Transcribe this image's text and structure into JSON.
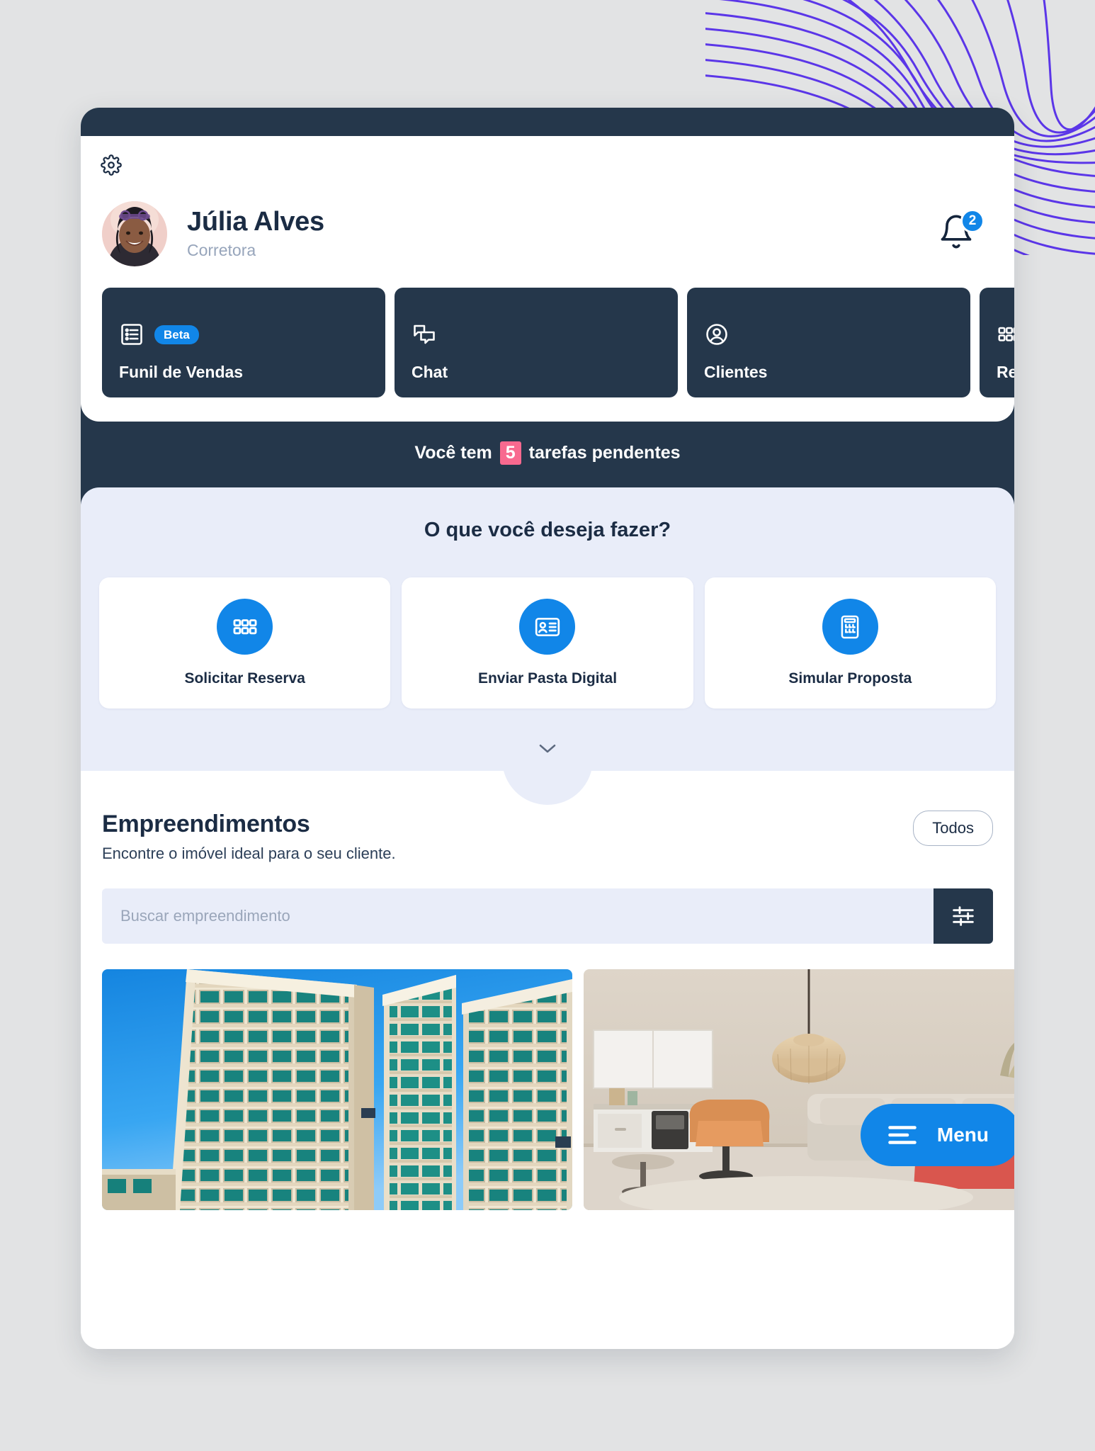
{
  "header": {
    "gear_icon": "gear-icon",
    "profile": {
      "name": "Júlia Alves",
      "role": "Corretora",
      "avatar_icon": "avatar"
    },
    "notifications": {
      "icon": "bell-icon",
      "count": "2"
    }
  },
  "nav_cards": [
    {
      "label": "Funil de Vendas",
      "icon": "list-icon",
      "badge": "Beta"
    },
    {
      "label": "Chat",
      "icon": "chat-bubbles-icon",
      "badge": ""
    },
    {
      "label": "Clientes",
      "icon": "user-circle-icon",
      "badge": ""
    },
    {
      "label": "Reservas",
      "icon": "grid-icon",
      "badge": ""
    }
  ],
  "tasks_banner": {
    "prefix": "Você  tem",
    "count": "5",
    "suffix": "tarefas pendentes"
  },
  "actions": {
    "title": "O que você deseja fazer?",
    "cards": [
      {
        "label": "Solicitar Reserva",
        "icon": "grid-icon"
      },
      {
        "label": "Enviar Pasta Digital",
        "icon": "id-card-icon"
      },
      {
        "label": "Simular Proposta",
        "icon": "calculator-icon"
      }
    ],
    "collapse_icon": "chevron-down-icon"
  },
  "listings": {
    "title": "Empreendimentos",
    "subtitle": "Encontre o imóvel ideal para o seu cliente.",
    "filter_pill": "Todos",
    "search_placeholder": "Buscar empreendimento",
    "search_value": "",
    "filter_button_icon": "sliders-icon",
    "gallery": [
      {
        "name": "building-exterior-photo"
      },
      {
        "name": "apartment-interior-photo"
      }
    ]
  },
  "menu_fab": {
    "label": "Menu",
    "icon": "hamburger-icon"
  },
  "colors": {
    "accent_blue": "#1186e8",
    "dark_navy": "#25374b",
    "panel_lilac": "#e9edf9",
    "badge_pink": "#f8698f",
    "page_bg": "#e2e3e4",
    "wave_purple": "#5b36e8"
  }
}
